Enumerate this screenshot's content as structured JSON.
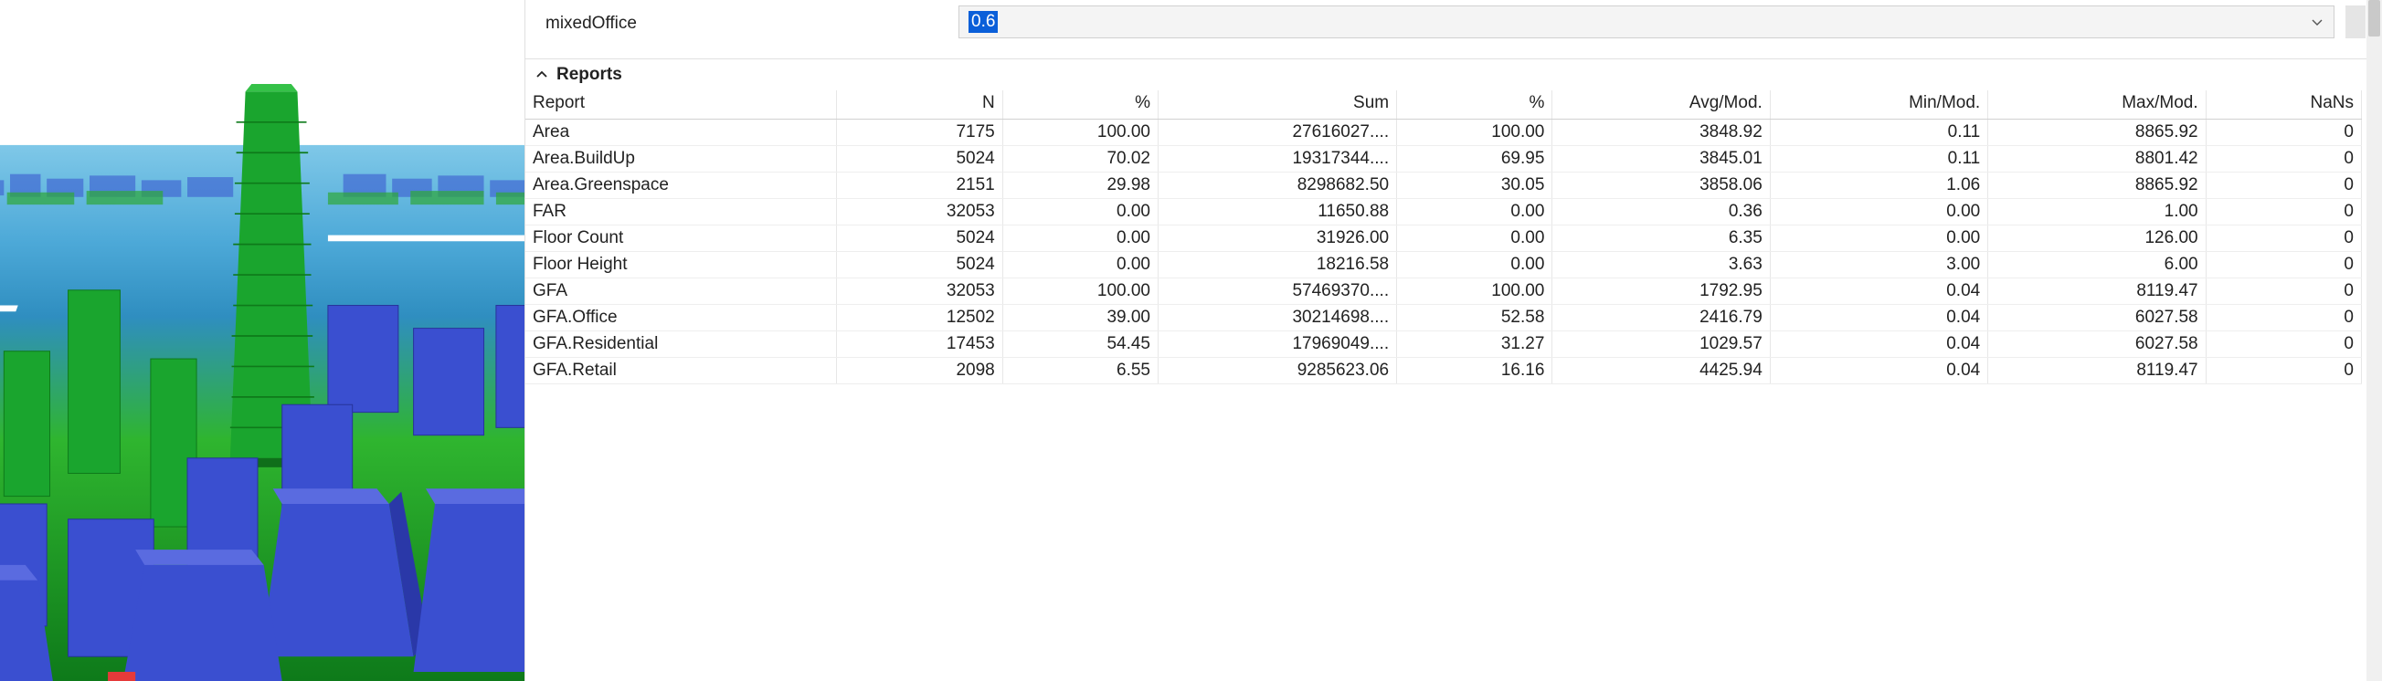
{
  "attribute": {
    "label": "mixedOffice",
    "value": "0.6"
  },
  "reports": {
    "section_title": "Reports",
    "columns": [
      "Report",
      "N",
      "%",
      "Sum",
      "%",
      "Avg/Mod.",
      "Min/Mod.",
      "Max/Mod.",
      "NaNs"
    ],
    "rows": [
      {
        "report": "Area",
        "n": "7175",
        "pct_n": "100.00",
        "sum": "27616027....",
        "pct_sum": "100.00",
        "avg": "3848.92",
        "min": "0.11",
        "max": "8865.92",
        "nans": "0"
      },
      {
        "report": "Area.BuildUp",
        "n": "5024",
        "pct_n": "70.02",
        "sum": "19317344....",
        "pct_sum": "69.95",
        "avg": "3845.01",
        "min": "0.11",
        "max": "8801.42",
        "nans": "0"
      },
      {
        "report": "Area.Greenspace",
        "n": "2151",
        "pct_n": "29.98",
        "sum": "8298682.50",
        "pct_sum": "30.05",
        "avg": "3858.06",
        "min": "1.06",
        "max": "8865.92",
        "nans": "0"
      },
      {
        "report": "FAR",
        "n": "32053",
        "pct_n": "0.00",
        "sum": "11650.88",
        "pct_sum": "0.00",
        "avg": "0.36",
        "min": "0.00",
        "max": "1.00",
        "nans": "0"
      },
      {
        "report": "Floor Count",
        "n": "5024",
        "pct_n": "0.00",
        "sum": "31926.00",
        "pct_sum": "0.00",
        "avg": "6.35",
        "min": "0.00",
        "max": "126.00",
        "nans": "0"
      },
      {
        "report": "Floor Height",
        "n": "5024",
        "pct_n": "0.00",
        "sum": "18216.58",
        "pct_sum": "0.00",
        "avg": "3.63",
        "min": "3.00",
        "max": "6.00",
        "nans": "0"
      },
      {
        "report": "GFA",
        "n": "32053",
        "pct_n": "100.00",
        "sum": "57469370....",
        "pct_sum": "100.00",
        "avg": "1792.95",
        "min": "0.04",
        "max": "8119.47",
        "nans": "0"
      },
      {
        "report": "GFA.Office",
        "n": "12502",
        "pct_n": "39.00",
        "sum": "30214698....",
        "pct_sum": "52.58",
        "avg": "2416.79",
        "min": "0.04",
        "max": "6027.58",
        "nans": "0"
      },
      {
        "report": "GFA.Residential",
        "n": "17453",
        "pct_n": "54.45",
        "sum": "17969049....",
        "pct_sum": "31.27",
        "avg": "1029.57",
        "min": "0.04",
        "max": "6027.58",
        "nans": "0"
      },
      {
        "report": "GFA.Retail",
        "n": "2098",
        "pct_n": "6.55",
        "sum": "9285623.06",
        "pct_sum": "16.16",
        "avg": "4425.94",
        "min": "0.04",
        "max": "8119.47",
        "nans": "0"
      }
    ]
  },
  "icons": {
    "chevron_down": "chevron-down-icon",
    "collapse_caret": "caret-up-icon"
  },
  "colors": {
    "selection": "#0a5fd9",
    "building_blue": "#3a4fd0",
    "building_green": "#18a030",
    "ground_green": "#2fb52f"
  }
}
